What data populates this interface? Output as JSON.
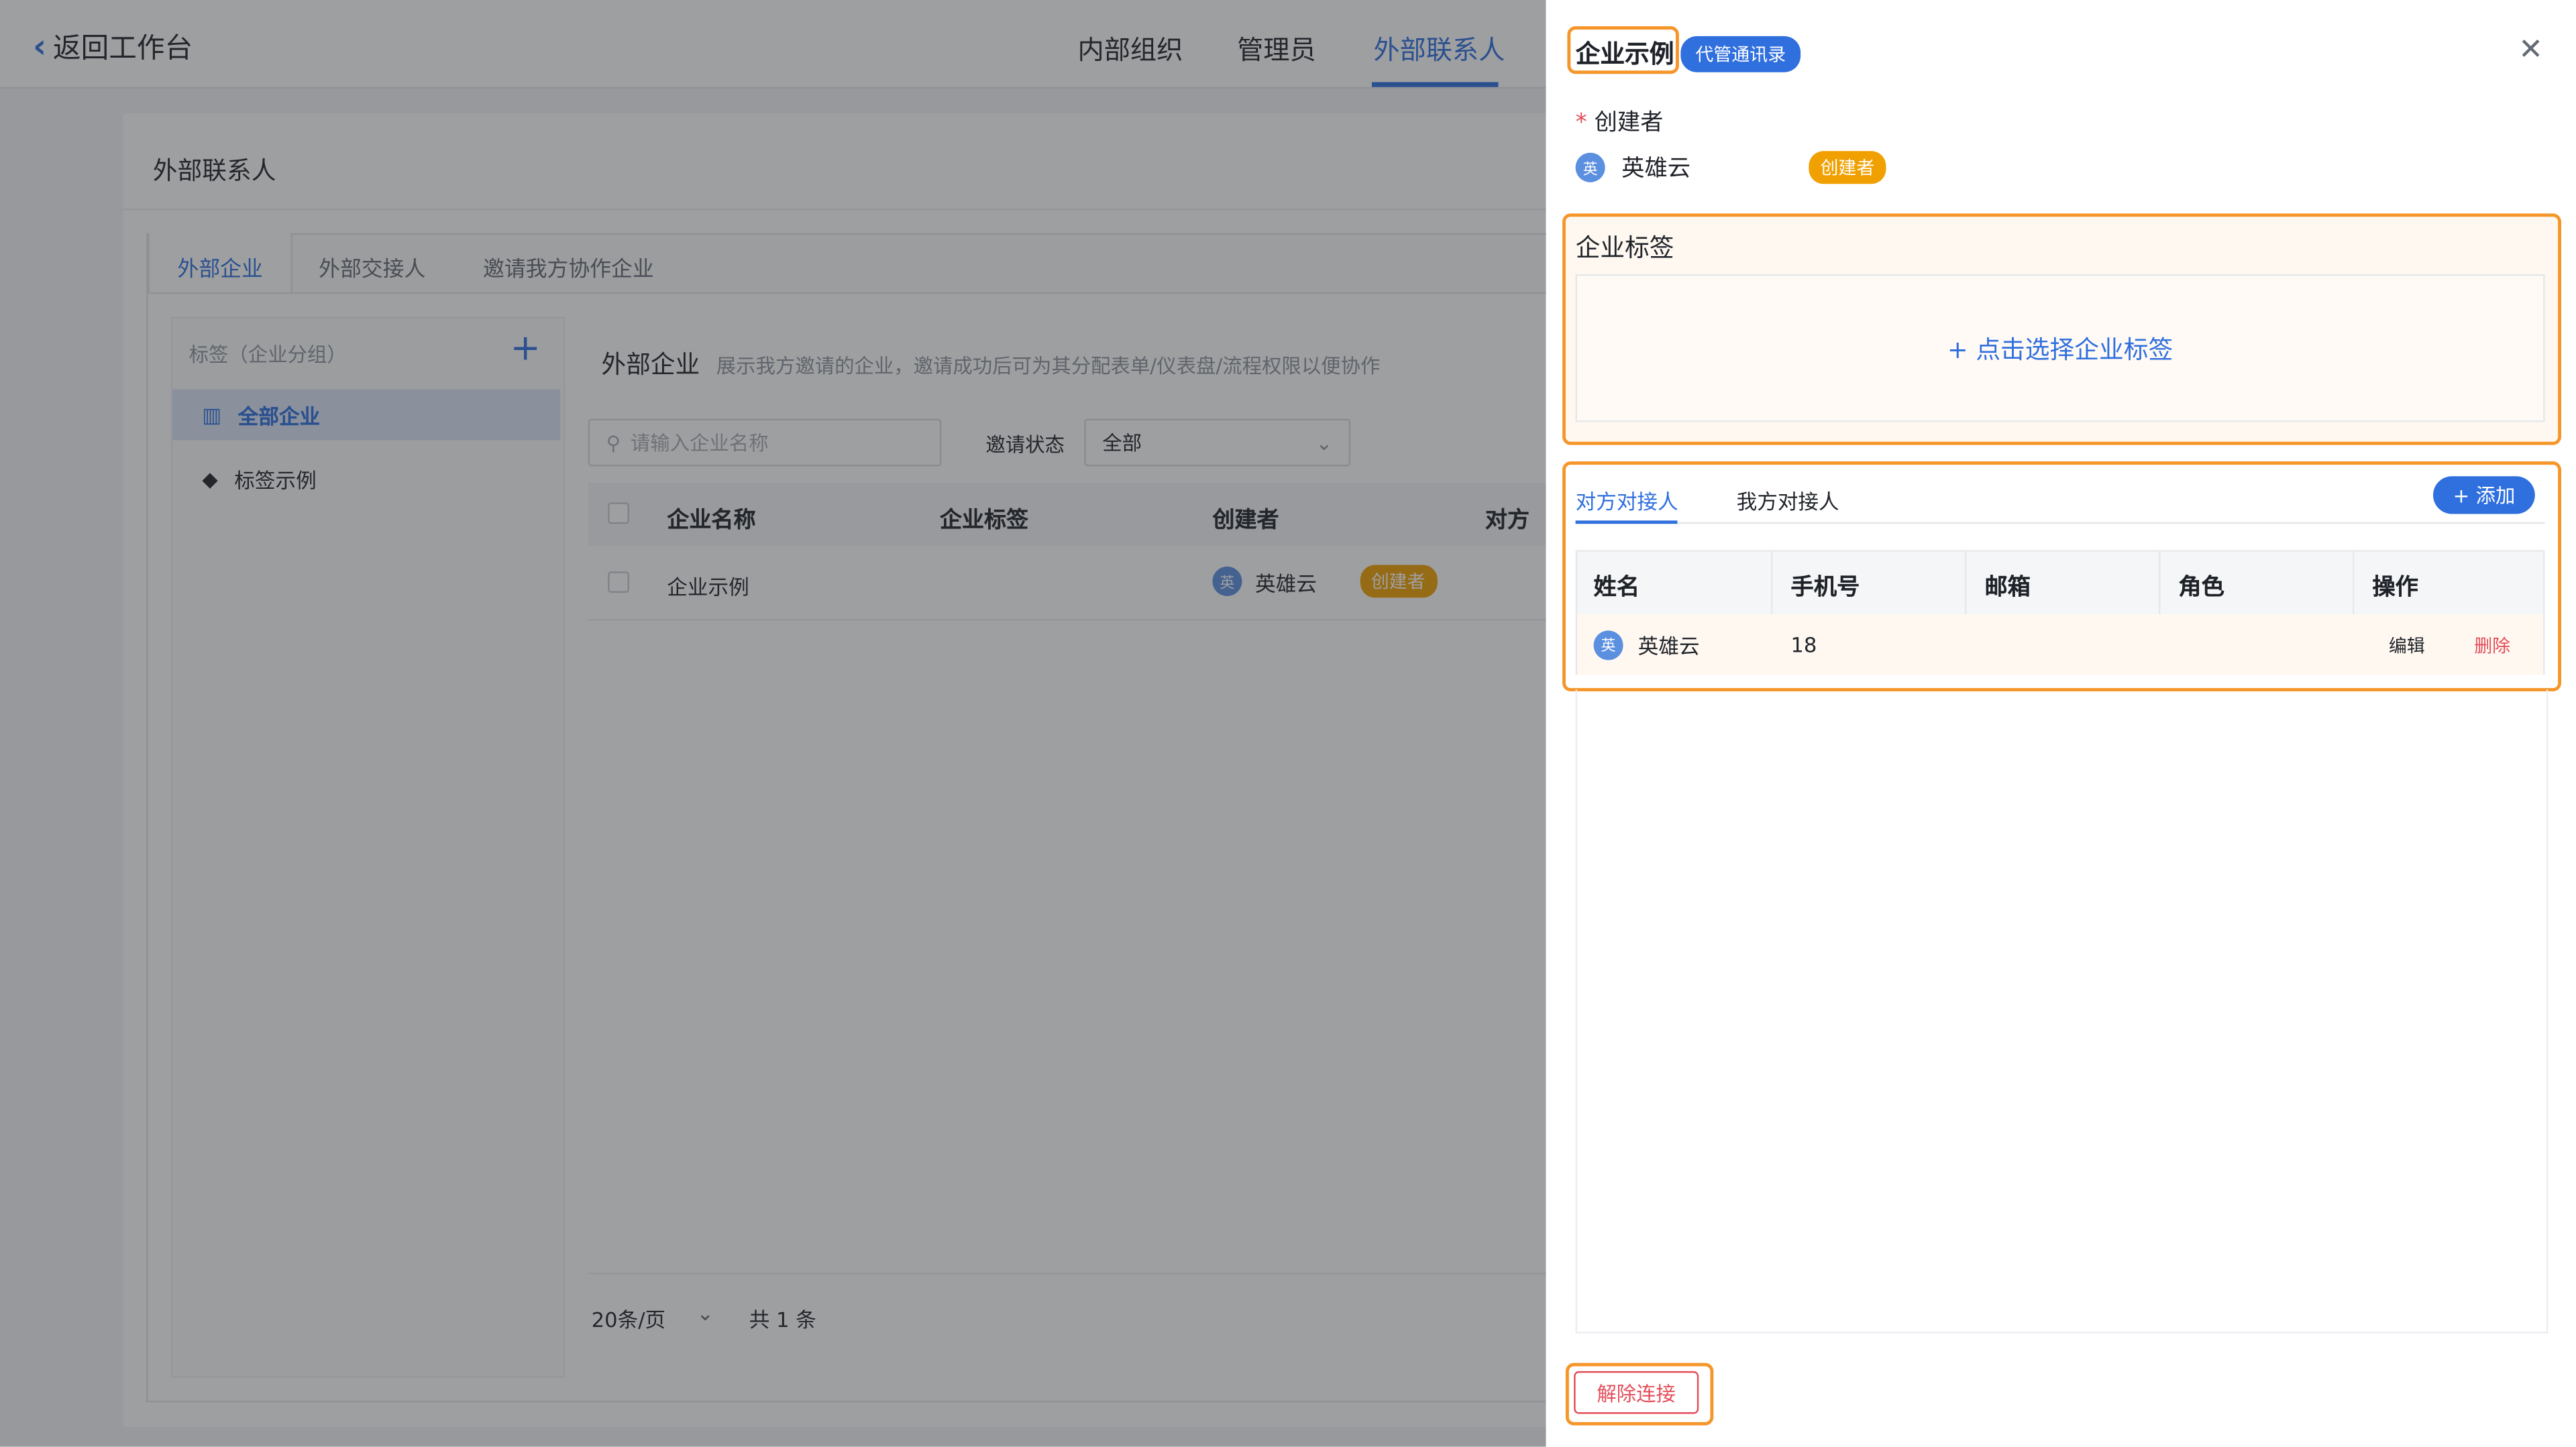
{
  "topbar": {
    "back_label": "返回工作台",
    "nav": [
      "内部组织",
      "管理员",
      "外部联系人"
    ]
  },
  "card": {
    "title": "外部联系人",
    "subtabs": [
      "外部企业",
      "外部交接人",
      "邀请我方协作企业"
    ]
  },
  "sidebar": {
    "header": "标签（企业分组）",
    "items": [
      {
        "label": "全部企业",
        "icon": "building-icon"
      },
      {
        "label": "标签示例",
        "icon": "tag-icon"
      }
    ]
  },
  "pane": {
    "title": "外部企业",
    "description": "展示我方邀请的企业，邀请成功后可为其分配表单/仪表盘/流程权限以便协作",
    "search_placeholder": "请输入企业名称",
    "status_label": "邀请状态",
    "status_value": "全部",
    "columns": [
      "企业名称",
      "企业标签",
      "创建者",
      "对方"
    ],
    "rows": [
      {
        "name": "企业示例",
        "tag": "",
        "creator": "英雄云",
        "badge": "创建者",
        "avatar": "英"
      }
    ],
    "page_size": "20条/页",
    "total": "共 1 条"
  },
  "drawer": {
    "title": "企业示例",
    "chip": "代管通讯录",
    "creator_label": "创建者",
    "creator_name": "英雄云",
    "creator_avatar": "英",
    "creator_badge": "创建者",
    "tag_title": "企业标签",
    "tag_action": "+ 点击选择企业标签",
    "contact_tabs": [
      "对方对接人",
      "我方对接人"
    ],
    "add_label": "+ 添加",
    "contact_columns": [
      "姓名",
      "手机号",
      "邮箱",
      "角色",
      "操作"
    ],
    "contacts": [
      {
        "name": "英雄云",
        "avatar": "英",
        "phone": "18",
        "email": "",
        "role": "",
        "edit": "编辑",
        "delete": "删除"
      }
    ],
    "unlink_label": "解除连接"
  },
  "colors": {
    "accent": "#2f6fde",
    "highlight": "#f5962a",
    "danger": "#e34d59",
    "badge": "#f0a000"
  }
}
